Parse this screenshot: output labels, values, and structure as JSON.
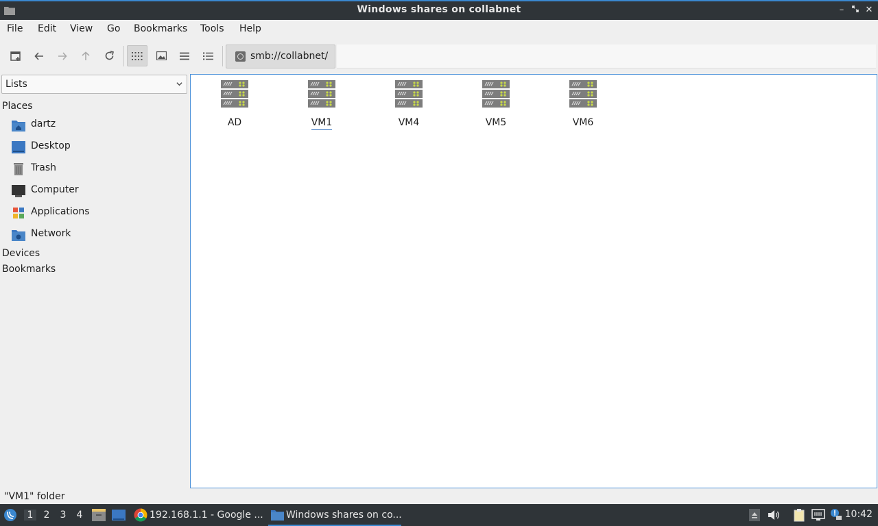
{
  "window": {
    "title": "Windows shares on collabnet"
  },
  "menu": [
    "File",
    "Edit",
    "View",
    "Go",
    "Bookmarks",
    "Tools",
    "Help"
  ],
  "toolbar": {
    "path_button": "smb://collabnet/"
  },
  "sidebar": {
    "combo_value": "Lists",
    "places_heading": "Places",
    "places": [
      {
        "label": "dartz",
        "icon": "home-folder-icon"
      },
      {
        "label": "Desktop",
        "icon": "desktop-icon"
      },
      {
        "label": "Trash",
        "icon": "trash-icon"
      },
      {
        "label": "Computer",
        "icon": "computer-icon"
      },
      {
        "label": "Applications",
        "icon": "applications-icon"
      },
      {
        "label": "Network",
        "icon": "network-folder-icon"
      }
    ],
    "devices_heading": "Devices",
    "bookmarks_heading": "Bookmarks"
  },
  "shares": [
    {
      "label": "AD"
    },
    {
      "label": "VM1",
      "selected": true
    },
    {
      "label": "VM4"
    },
    {
      "label": "VM5"
    },
    {
      "label": "VM6"
    }
  ],
  "statusbar": {
    "text": "\"VM1\" folder"
  },
  "taskbar": {
    "desktops": [
      "1",
      "2",
      "3",
      "4"
    ],
    "tasks": [
      {
        "label": "192.168.1.1 - Google ...",
        "icon": "chrome-icon"
      },
      {
        "label": "Windows shares on co...",
        "icon": "file-manager-icon",
        "active": true
      }
    ],
    "clock": "10:42"
  },
  "colors": {
    "accent": "#3a87cf",
    "titlebar": "#2f3438",
    "folder_blue": "#4a86c8"
  }
}
